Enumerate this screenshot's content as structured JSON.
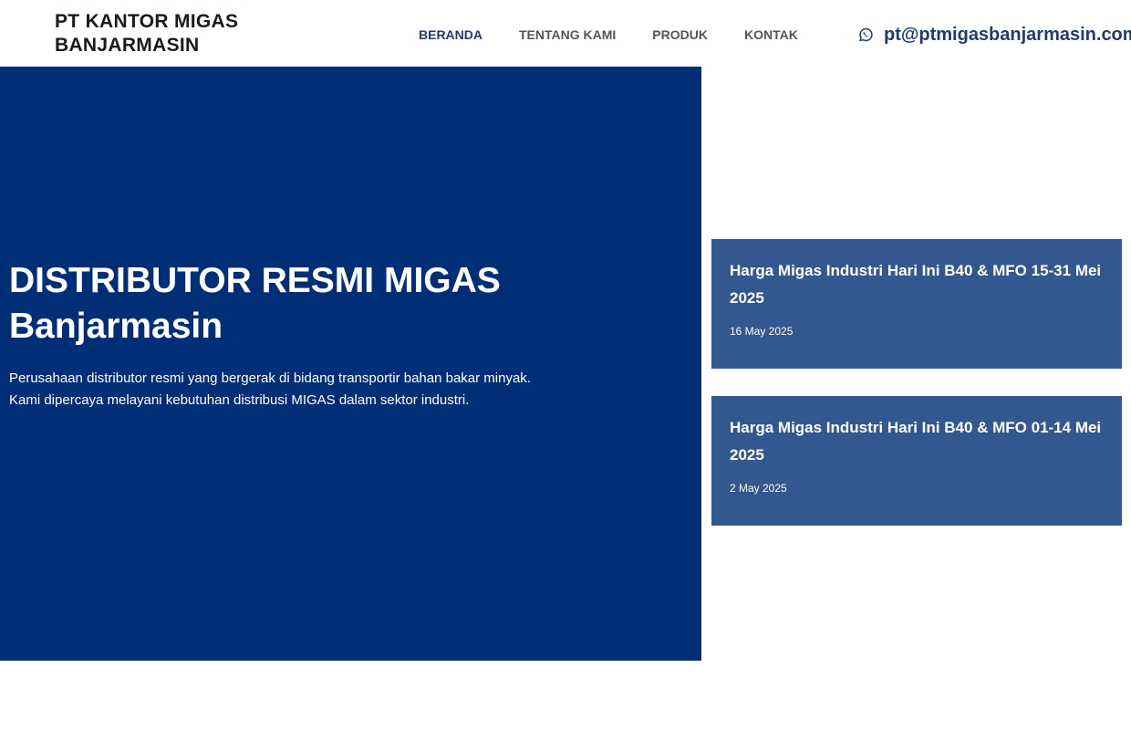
{
  "header": {
    "brand": "PT KANTOR MIGAS BANJARMASIN",
    "nav": [
      {
        "label": "BERANDA"
      },
      {
        "label": "TENTANG KAMI"
      },
      {
        "label": "PRODUK"
      },
      {
        "label": "KONTAK"
      }
    ],
    "contact_icon": "whatsapp-icon",
    "contact_email": "pt@ptmigasbanjarmasin.com"
  },
  "hero": {
    "title_line1": "DISTRIBUTOR RESMI MIGAS",
    "title_line2": "Banjarmasin",
    "text_line1": "Perusahaan distributor resmi yang bergerak di bidang transportir bahan bakar minyak.",
    "text_line2": "Kami dipercaya melayani kebutuhan distribusi MIGAS dalam sektor industri."
  },
  "posts": [
    {
      "title": "Harga Migas Industri Hari Ini B40 & MFO 15-31 Mei 2025",
      "date": "16 May 2025"
    },
    {
      "title": "Harga Migas Industri Hari Ini B40 & MFO 01-14 Mei 2025",
      "date": "2 May 2025"
    }
  ],
  "colors": {
    "hero_bg": "#002f78",
    "card_bg": "#33578f",
    "accent": "#1f3c72"
  }
}
